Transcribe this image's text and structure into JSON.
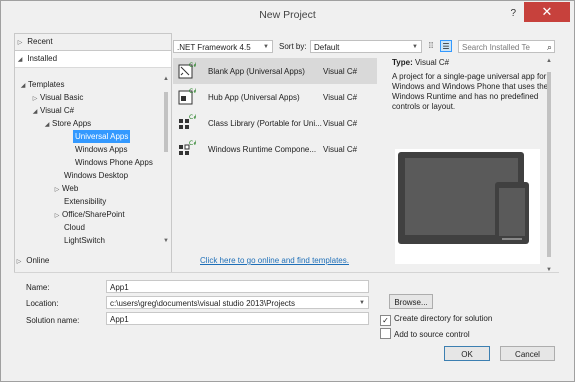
{
  "window": {
    "title": "New Project",
    "help_label": "?",
    "close_label": "✕"
  },
  "left_pane": {
    "recent": "Recent",
    "installed": "Installed",
    "online": "Online",
    "tree": [
      {
        "label": "Templates",
        "expander": "◢"
      },
      {
        "label": "Visual Basic",
        "expander": "▷"
      },
      {
        "label": "Visual C#",
        "expander": "◢"
      },
      {
        "label": "Store Apps",
        "expander": "◢"
      },
      {
        "label": "Universal Apps",
        "expander": ""
      },
      {
        "label": "Windows Apps",
        "expander": ""
      },
      {
        "label": "Windows Phone Apps",
        "expander": ""
      },
      {
        "label": "Windows Desktop",
        "expander": ""
      },
      {
        "label": "Web",
        "expander": "▷"
      },
      {
        "label": "Extensibility",
        "expander": ""
      },
      {
        "label": "Office/SharePoint",
        "expander": "▷"
      },
      {
        "label": "Cloud",
        "expander": ""
      },
      {
        "label": "LightSwitch",
        "expander": ""
      }
    ]
  },
  "toolbar": {
    "framework": ".NET Framework 4.5",
    "sort_label": "Sort by:",
    "sort_value": "Default",
    "search_placeholder": "Search Installed Te"
  },
  "templates": [
    {
      "name": "Blank App (Universal Apps)",
      "language": "Visual C#",
      "selected": true
    },
    {
      "name": "Hub App (Universal Apps)",
      "language": "Visual C#",
      "selected": false
    },
    {
      "name": "Class Library (Portable for Uni...",
      "language": "Visual C#",
      "selected": false
    },
    {
      "name": "Windows Runtime Compone...",
      "language": "Visual C#",
      "selected": false
    }
  ],
  "online_link": "Click here to go online and find templates.",
  "description": {
    "type_label": "Type:",
    "type_value": "Visual C#",
    "text": "A project for a single-page universal app for Windows and Windows Phone that uses the Windows Runtime and has no predefined controls or layout."
  },
  "form": {
    "name_label": "Name:",
    "name_value": "App1",
    "location_label": "Location:",
    "location_value": "c:\\users\\greg\\documents\\visual studio 2013\\Projects",
    "solution_label": "Solution name:",
    "solution_value": "App1",
    "browse_label": "Browse...",
    "create_dir_label": "Create directory for solution",
    "create_dir_checked": true,
    "add_source_label": "Add to source control",
    "add_source_checked": false,
    "ok_label": "OK",
    "cancel_label": "Cancel"
  },
  "colors": {
    "selection": "#3399ff",
    "close": "#c7413c",
    "link": "#1e6fb8"
  }
}
